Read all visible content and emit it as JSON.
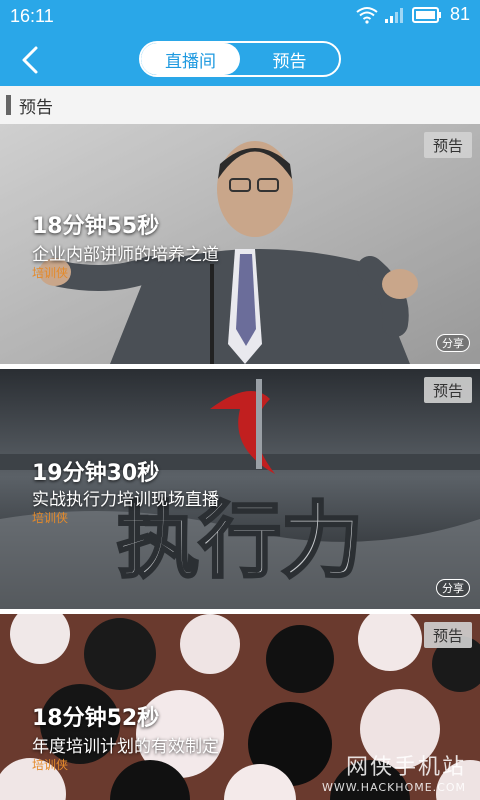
{
  "status_bar": {
    "time": "16:11",
    "battery": "81"
  },
  "nav": {
    "back_icon": "back-arrow-icon",
    "tabs": [
      {
        "label": "直播间",
        "active": true
      },
      {
        "label": "预告",
        "active": false
      }
    ]
  },
  "section": {
    "title": "预告"
  },
  "cards": [
    {
      "badge": "预告",
      "duration": "18分钟55秒",
      "title": "企业内部讲师的培养之道",
      "tag": "培训侠",
      "share": "分享"
    },
    {
      "badge": "预告",
      "duration": "19分钟30秒",
      "title": "实战执行力培训现场直播",
      "tag": "培训侠",
      "share": "分享",
      "banner_text": "执行力"
    },
    {
      "badge": "预告",
      "duration": "18分钟52秒",
      "title": "年度培训计划的有效制定",
      "tag": "培训侠"
    }
  ],
  "watermark": {
    "main": "网侠手机站",
    "sub": "WWW.HACKHOME.COM"
  },
  "colors": {
    "accent": "#2aa7e8",
    "tag": "#e48a2a"
  }
}
